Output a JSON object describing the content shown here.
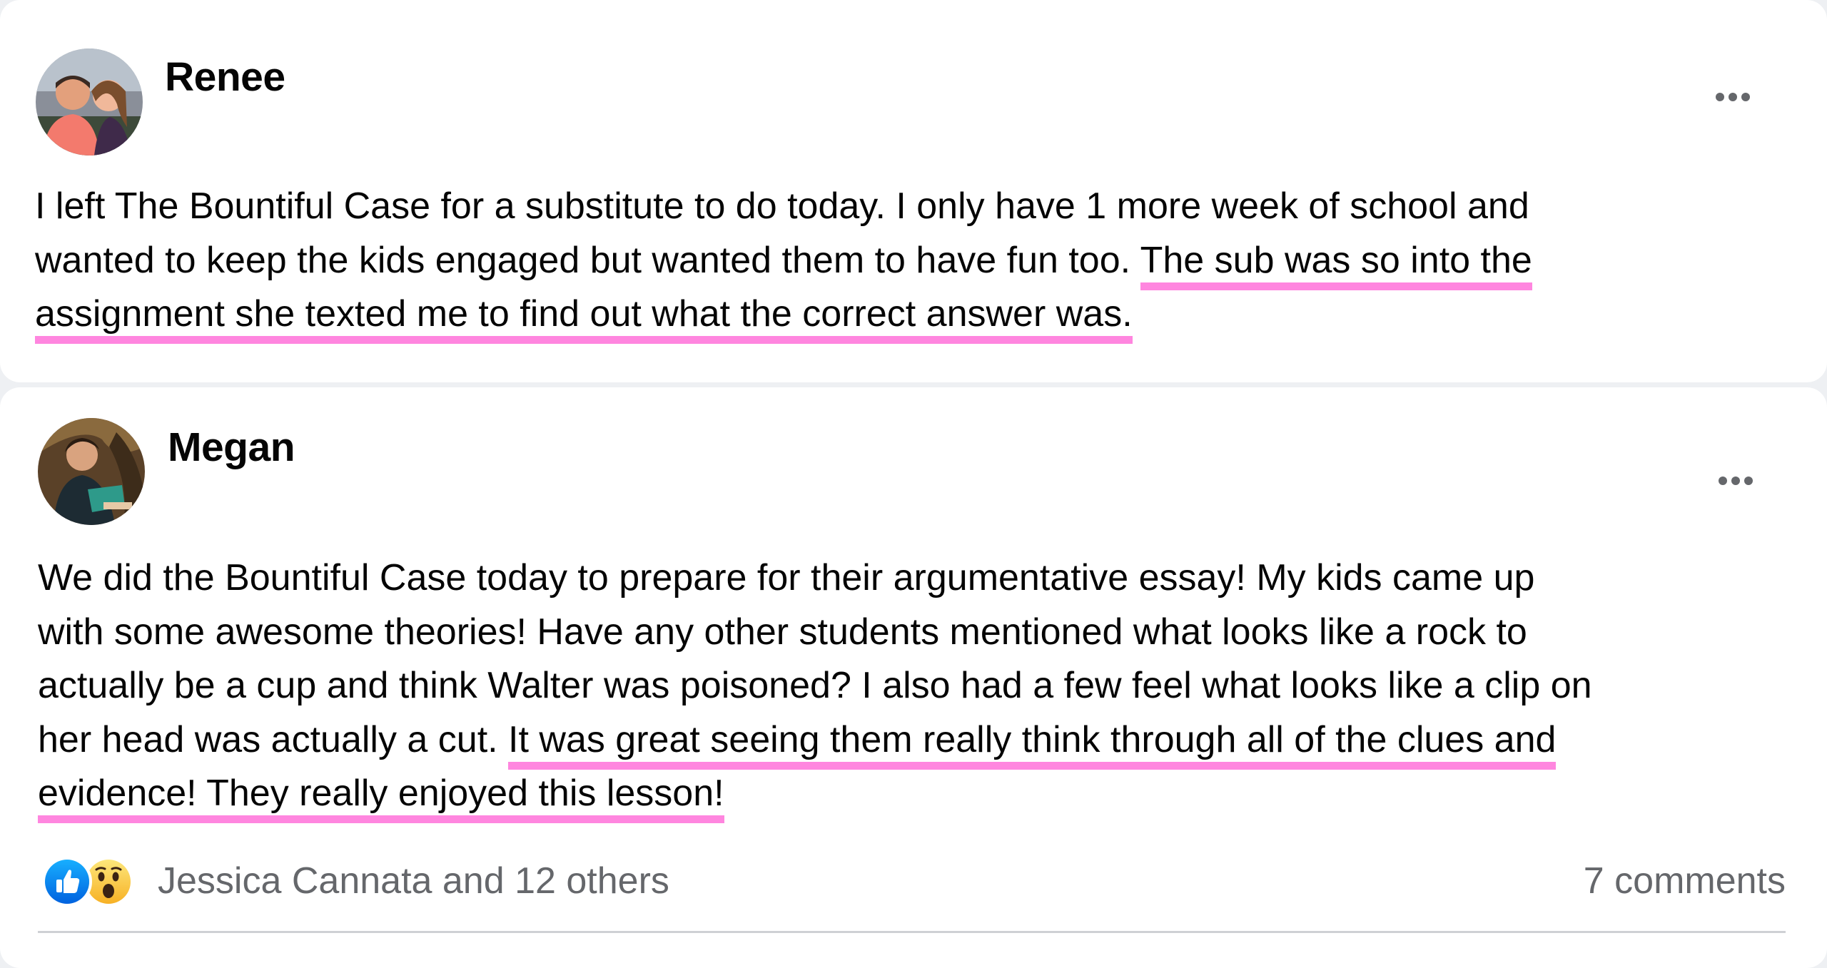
{
  "posts": [
    {
      "author": "Renee",
      "avatar_icon": "avatar-photo",
      "more_icon": "more-options-icon",
      "text_lines": [
        {
          "plain": "I left The Bountiful Case for a substitute to do today.  I only have 1 more week of school and",
          "highlight": ""
        },
        {
          "plain": "wanted to keep the kids engaged but wanted them to have fun too.  ",
          "highlight": "The sub was so into the"
        },
        {
          "plain": "",
          "highlight": "assignment she texted me to find out what the correct answer was."
        }
      ]
    },
    {
      "author": "Megan",
      "avatar_icon": "avatar-photo",
      "more_icon": "more-options-icon",
      "text_lines": [
        {
          "plain": "We did the Bountiful Case today to prepare for their argumentative essay! My kids came up",
          "highlight": ""
        },
        {
          "plain": "with some awesome theories! Have any other students mentioned what looks like a rock to",
          "highlight": ""
        },
        {
          "plain": "actually be a cup and think Walter was poisoned? I also had a few feel what looks like a clip on",
          "highlight": ""
        },
        {
          "plain": "her head was actually a cut. ",
          "highlight": "It was great seeing them really think through all of the clues and"
        },
        {
          "plain": "",
          "highlight": "evidence! They really enjoyed this lesson!"
        }
      ],
      "reactions": [
        "like-icon",
        "wow-icon"
      ],
      "reactors": "Jessica Cannata and 12 others",
      "comments": "7 comments"
    }
  ],
  "colors": {
    "highlight": "#ff86df",
    "like_blue": "#1877f2",
    "wow_yellow": "#f7b125",
    "muted_text": "#65676b",
    "background": "#eef0f3"
  }
}
